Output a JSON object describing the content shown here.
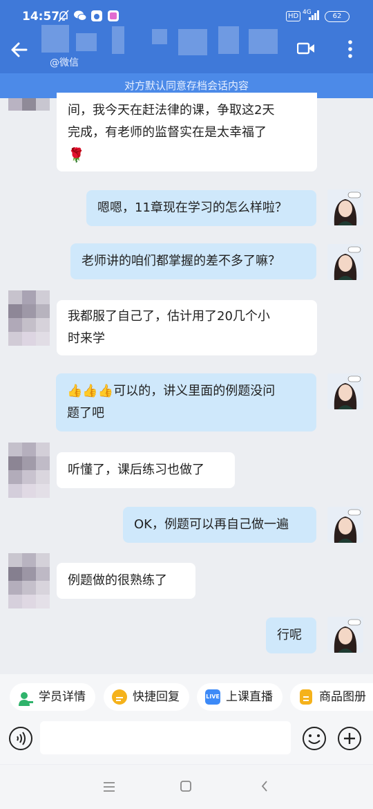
{
  "status_bar": {
    "time": "14:57",
    "network": "4G",
    "battery": "62",
    "hd": "HD"
  },
  "header": {
    "subtitle": "@微信",
    "back_icon": "arrow-left-icon",
    "video_icon": "video-call-icon",
    "more_icon": "more-vertical-icon"
  },
  "notice": "对方默认同意存档会话内容",
  "messages": [
    {
      "side": "in",
      "lines": [
        "间，我今天在赶法律的课，争取这2天",
        "完成，有老师的监督实在是太幸福了"
      ],
      "emoji": "🌹"
    },
    {
      "side": "out",
      "text": "嗯嗯，11章现在学习的怎么样啦？"
    },
    {
      "side": "out",
      "text": "老师讲的咱们都掌握的差不多了嘛？"
    },
    {
      "side": "in",
      "lines": [
        "我都服了自己了，估计用了20几个小",
        "时来学"
      ]
    },
    {
      "side": "out",
      "emoji": "👍👍👍",
      "lines": [
        "可以的，讲义里面的例题没问",
        "题了吧"
      ]
    },
    {
      "side": "in",
      "text": "听懂了，课后练习也做了"
    },
    {
      "side": "out",
      "text": "OK，例题可以再自己做一遍"
    },
    {
      "side": "in",
      "text": "例题做的很熟练了"
    },
    {
      "side": "out",
      "text": "行呢"
    }
  ],
  "quick_actions": [
    {
      "label": "学员详情",
      "icon": "student-icon",
      "color": "#2fb36b"
    },
    {
      "label": "快捷回复",
      "icon": "quick-reply-icon",
      "color": "#f5b21b"
    },
    {
      "label": "上课直播",
      "icon": "live-icon",
      "color": "#3d8af7",
      "badge": "LIVE"
    },
    {
      "label": "商品图册",
      "icon": "catalog-icon",
      "color": "#f5b21b"
    }
  ],
  "input": {
    "placeholder": "",
    "voice_icon": "voice-icon",
    "emoji_icon": "emoji-icon",
    "plus_icon": "plus-icon"
  },
  "nav": {
    "menu_icon": "menu-icon",
    "home_icon": "home-icon",
    "back_icon": "back-icon"
  }
}
